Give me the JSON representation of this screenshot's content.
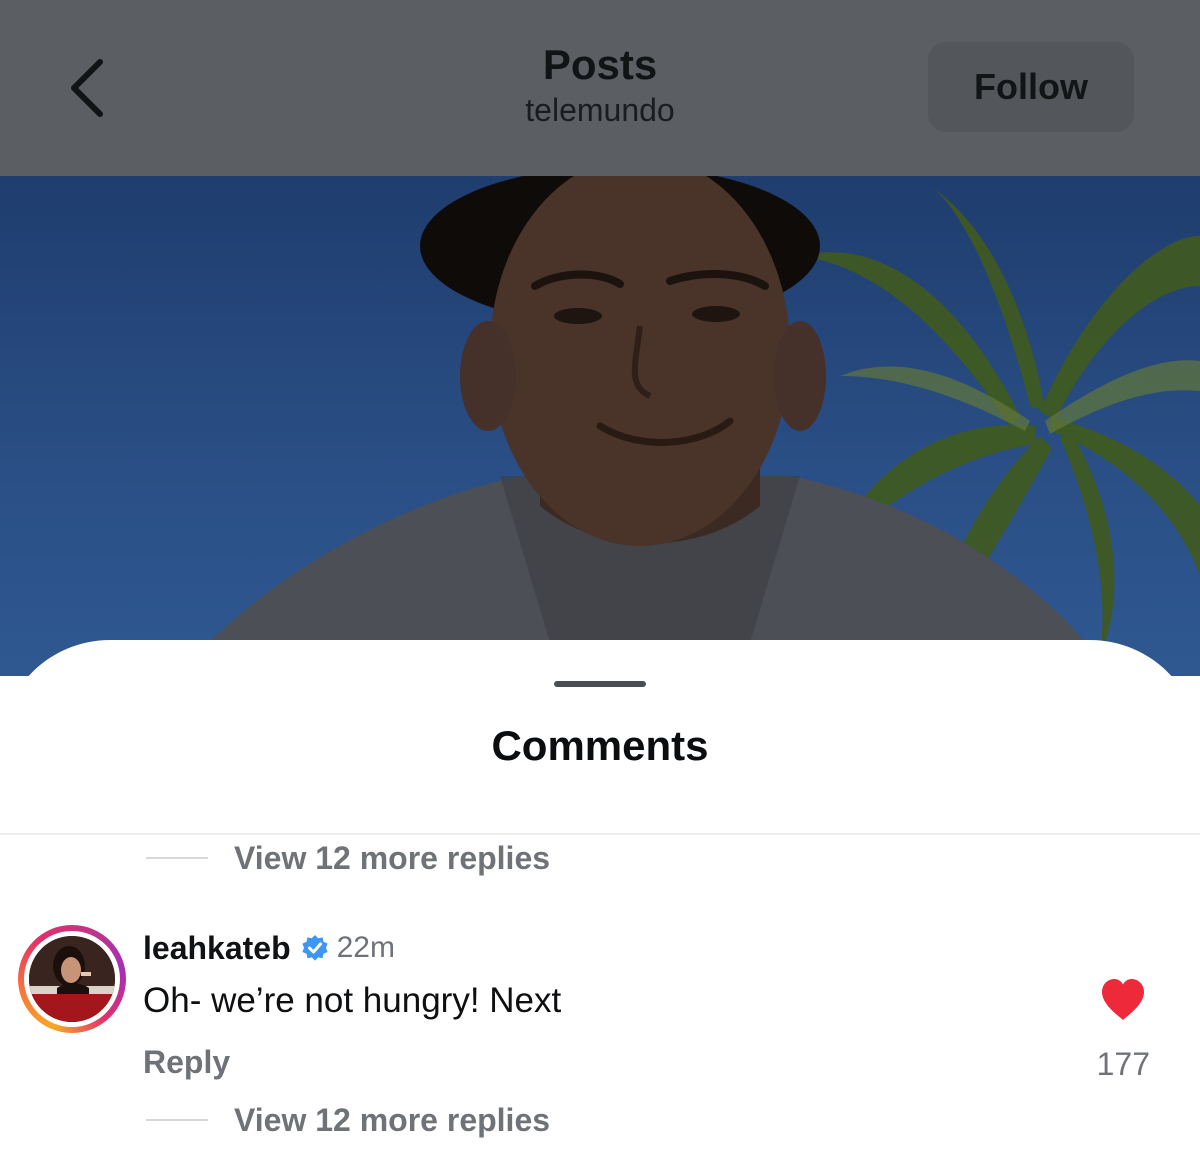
{
  "header": {
    "title": "Posts",
    "subtitle": "telemundo",
    "follow_label": "Follow"
  },
  "sheet": {
    "title": "Comments",
    "view_replies_top": "View 12 more replies",
    "view_replies_bottom": "View 12 more replies"
  },
  "comment": {
    "username": "leahkateb",
    "verified": true,
    "timestamp": "22m",
    "text": "Oh- we’re not hungry! Next",
    "reply_label": "Reply",
    "like_count": "177",
    "liked": true
  },
  "icons": {
    "back": "chevron-left-icon",
    "verified": "verified-badge-icon",
    "like": "heart-icon"
  },
  "colors": {
    "header_dimmed": "#5b5f64",
    "like_red": "#ee2a3a",
    "verified_blue": "#3d96f4",
    "secondary_text": "#6f7378"
  }
}
